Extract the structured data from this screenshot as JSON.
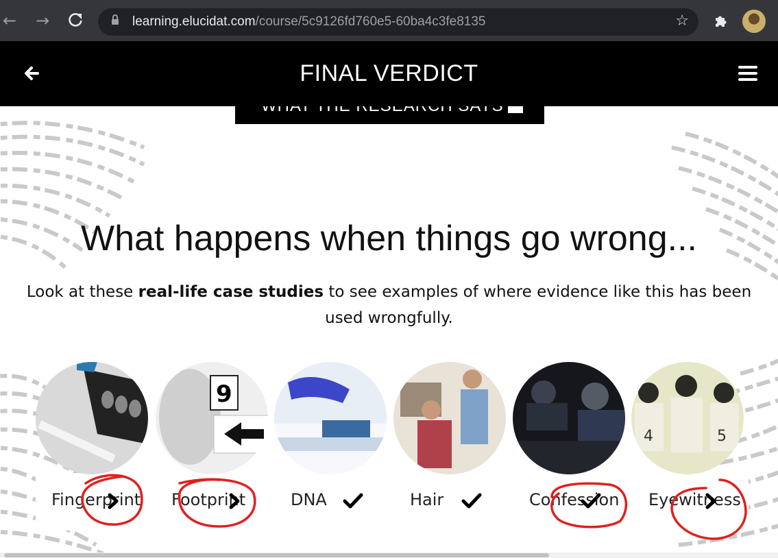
{
  "browser": {
    "url_host": "learning.elucidat.com",
    "url_path": "/course/5c9126fd760e5-60ba4c3fe8135",
    "back_icon": "arrow-left-icon",
    "forward_icon": "arrow-right-icon",
    "reload_icon": "reload-icon"
  },
  "header": {
    "title": "FINAL VERDICT",
    "back_icon": "arrow-left-icon",
    "menu_icon": "hamburger-menu-icon"
  },
  "section_tab": {
    "label": "WHAT THE RESEARCH SAYS"
  },
  "main": {
    "heading": "What happens when things go wrong...",
    "subtext_before": "Look at these ",
    "subtext_bold": "real-life case studies",
    "subtext_after": " to see examples of where evidence like this has been used wrongfully."
  },
  "cases": [
    {
      "label": "Fingerprint",
      "status": "chevron-right-icon"
    },
    {
      "label": "Footprint",
      "status": "chevron-right-icon"
    },
    {
      "label": "DNA",
      "status": "checkmark-icon"
    },
    {
      "label": "Hair",
      "status": "checkmark-icon"
    },
    {
      "label": "Confession",
      "status": "checkmark-icon"
    },
    {
      "label": "Eyewitness",
      "status": "chevron-right-icon"
    }
  ],
  "colors": {
    "header_bg": "#000000",
    "annotation": "#e0201e",
    "text": "#111111"
  }
}
